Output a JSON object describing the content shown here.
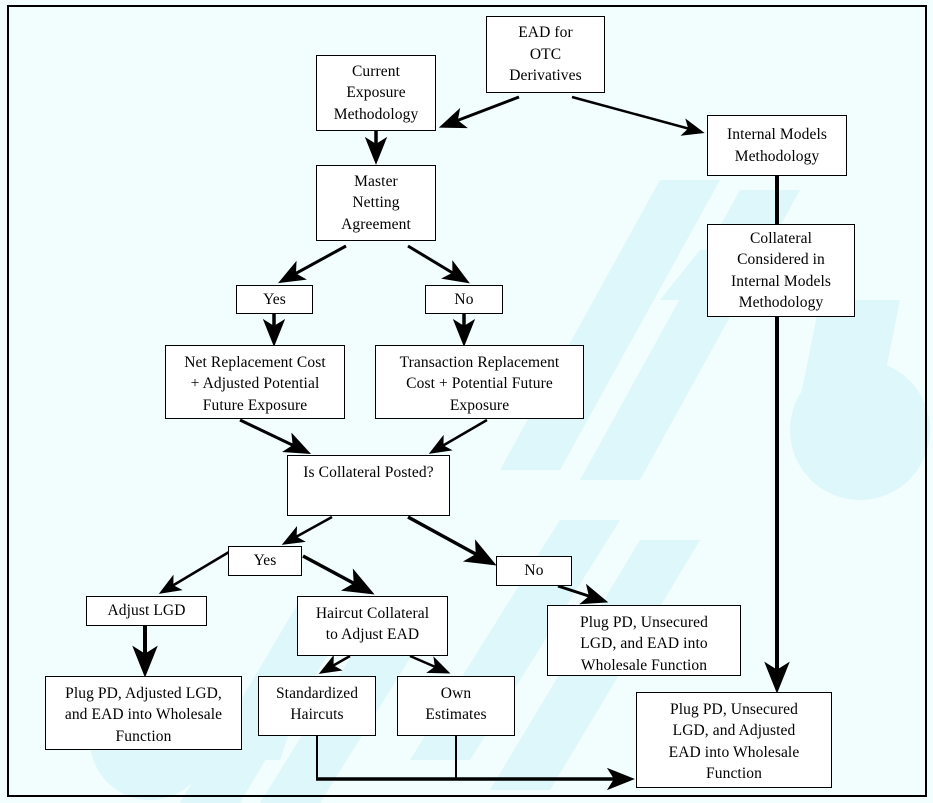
{
  "diagram": {
    "title": "EAD for OTC Derivatives",
    "background_color": "#f2fdfd",
    "node_fill_color": "#ffffff",
    "line_color": "#000000",
    "watermark_color": "#ddf7fb"
  },
  "nodes": {
    "ead_otc": {
      "label": "EAD for\nOTC\nDerivatives"
    },
    "current_exposure": {
      "label": "Current\nExposure\nMethodology"
    },
    "internal_models": {
      "label": "Internal Models\nMethodology"
    },
    "master_netting": {
      "label": "Master\nNetting\nAgreement"
    },
    "collateral_internal_models": {
      "label": "Collateral\nConsidered in\nInternal Models\nMethodology"
    },
    "netting_yes": {
      "label": "Yes"
    },
    "netting_no": {
      "label": "No"
    },
    "net_replacement": {
      "label": "Net Replacement Cost\n+ Adjusted Potential\nFuture Exposure"
    },
    "transaction_replacement": {
      "label": "Transaction Replacement\nCost + Potential Future\nExposure"
    },
    "is_collateral_posted": {
      "label": "Is Collateral Posted?"
    },
    "collateral_yes": {
      "label": "Yes"
    },
    "collateral_no": {
      "label": "No"
    },
    "adjust_lgd": {
      "label": "Adjust LGD"
    },
    "haircut_collateral": {
      "label": "Haircut Collateral\nto Adjust EAD"
    },
    "plug_unsecured_ead": {
      "label": "Plug PD, Unsecured\nLGD, and EAD into\nWholesale Function"
    },
    "plug_adjusted_lgd": {
      "label": "Plug PD, Adjusted LGD,\nand EAD into Wholesale\nFunction"
    },
    "standardized_haircuts": {
      "label": "Standardized\nHaircuts"
    },
    "own_estimates": {
      "label": "Own\nEstimates"
    },
    "plug_unsecured_adjusted_ead": {
      "label": "Plug PD, Unsecured\nLGD, and Adjusted\nEAD into Wholesale\nFunction"
    }
  }
}
